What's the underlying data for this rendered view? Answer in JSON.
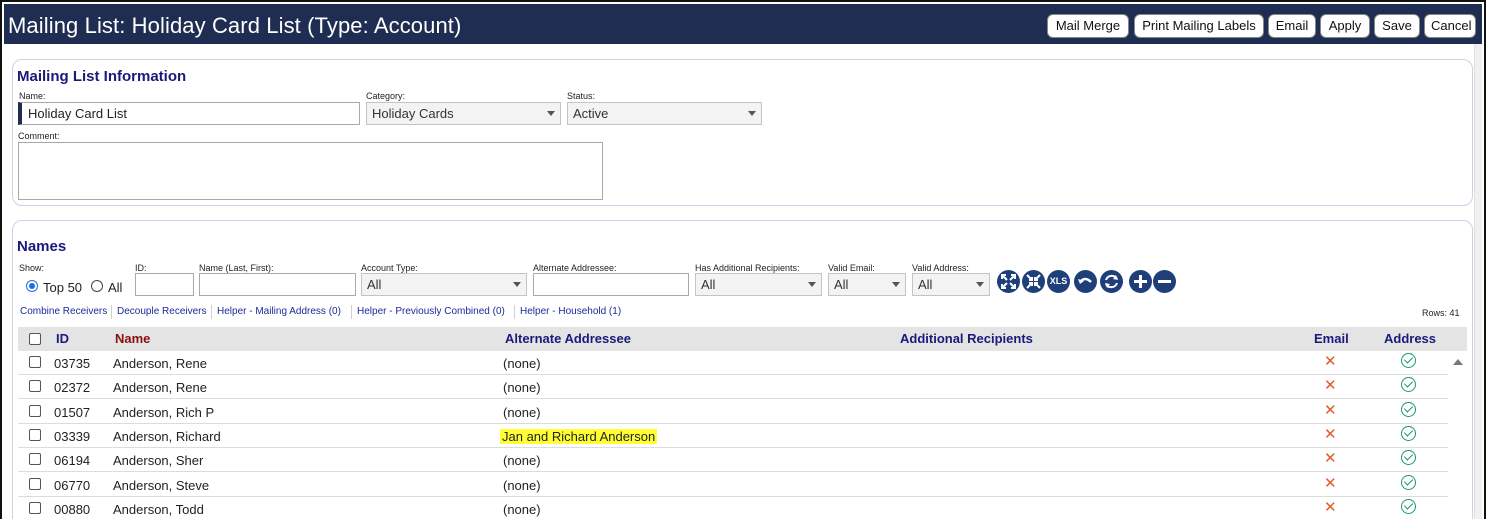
{
  "header": {
    "title": "Mailing List: Holiday Card List (Type: Account)",
    "buttons": {
      "mail_merge": "Mail Merge",
      "print_labels": "Print Mailing Labels",
      "email": "Email",
      "apply": "Apply",
      "save": "Save",
      "cancel": "Cancel"
    },
    "bar_color": "#1f2d52"
  },
  "info": {
    "title": "Mailing List Information",
    "name_label": "Name:",
    "name_value": "Holiday Card List",
    "category_label": "Category:",
    "category_value": "Holiday Cards",
    "status_label": "Status:",
    "status_value": "Active",
    "comment_label": "Comment:"
  },
  "names": {
    "title": "Names",
    "show_label": "Show:",
    "show_top": "Top 50",
    "show_all": "All",
    "id_label": "ID:",
    "name_label": "Name (Last, First):",
    "account_type_label": "Account Type:",
    "account_type_value": "All",
    "alt_addressee_label": "Alternate Addressee:",
    "has_additional_label": "Has Additional Recipients:",
    "has_additional_value": "All",
    "valid_email_label": "Valid Email:",
    "valid_email_value": "All",
    "valid_address_label": "Valid Address:",
    "valid_address_value": "All",
    "xls_label": "XLS",
    "links": {
      "combine": "Combine Receivers",
      "decouple": "Decouple Receivers",
      "helper_mailing": "Helper - Mailing Address (0)",
      "helper_combined": "Helper - Previously Combined (0)",
      "helper_household": "Helper - Household (1)"
    },
    "rows_count": "Rows: 41"
  },
  "grid": {
    "columns": {
      "id": "ID",
      "name": "Name",
      "alternate": "Alternate Addressee",
      "additional": "Additional Recipients",
      "email": "Email",
      "address": "Address"
    },
    "rows": [
      {
        "id": "03735",
        "name": "Anderson, Rene",
        "alternate": "(none)"
      },
      {
        "id": "02372",
        "name": "Anderson, Rene",
        "alternate": "(none)"
      },
      {
        "id": "01507",
        "name": "Anderson, Rich P",
        "alternate": "(none)"
      },
      {
        "id": "03339",
        "name": "Anderson, Richard",
        "alternate": "Jan and Richard Anderson"
      },
      {
        "id": "06194",
        "name": "Anderson, Sher",
        "alternate": "(none)"
      },
      {
        "id": "06770",
        "name": "Anderson, Steve",
        "alternate": "(none)"
      },
      {
        "id": "00880",
        "name": "Anderson, Todd",
        "alternate": "(none)"
      }
    ],
    "highlight_color": "#ffff33",
    "email_invalid_color": "#e05a2b",
    "address_valid_color": "#1a9a62"
  }
}
